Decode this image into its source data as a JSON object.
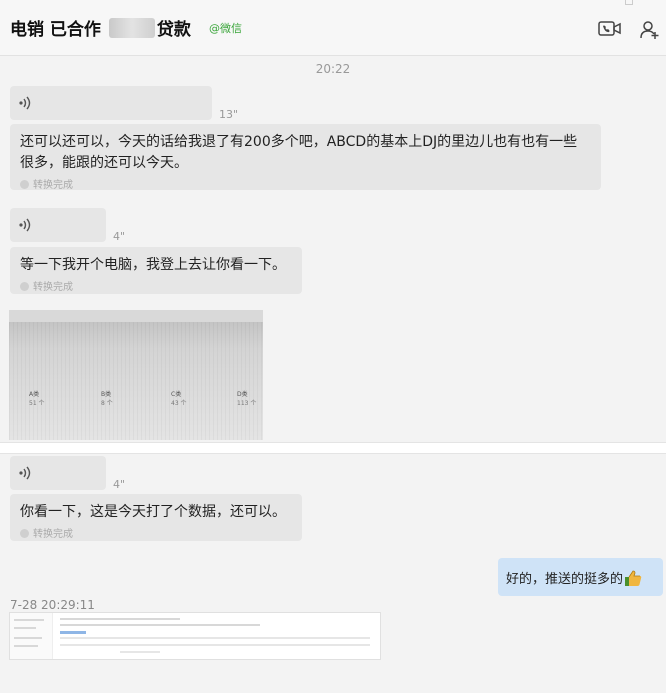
{
  "header": {
    "title_a": "电销 已合作 ",
    "title_b": "贷款",
    "title_mid": "",
    "tag": "@微信"
  },
  "messages": {
    "time1": "20:22",
    "voice1": {
      "duration": "13\""
    },
    "text1": "还可以还可以，今天的话给我退了有200多个吧，ABCD的基本上DJ的里边儿也有也有一些很多，能跟的还可以今天。",
    "voice2": {
      "duration": "4\""
    },
    "text2": "等一下我开个电脑，我登上去让你看一下。",
    "photo": {
      "labels": [
        "A类",
        "B类",
        "C类",
        "D类"
      ],
      "values": [
        "51 个",
        "8 个",
        "43 个",
        "113 个"
      ]
    },
    "voice3": {
      "duration": "4\""
    },
    "text3": "你看一下，这是今天打了个数据，还可以。",
    "status": "转换完成",
    "mine_text": "好的，推送的挺多的",
    "time2": "7-28 20:29:11"
  },
  "colors": {
    "bubble_other": "#e6e6e6",
    "bubble_mine": "#cfe3f7",
    "tag_green": "#3aa53a"
  },
  "icons": [
    "video-call-icon",
    "add-contact-icon",
    "voice-wave-icon",
    "check-icon",
    "thumbs-up-icon"
  ]
}
